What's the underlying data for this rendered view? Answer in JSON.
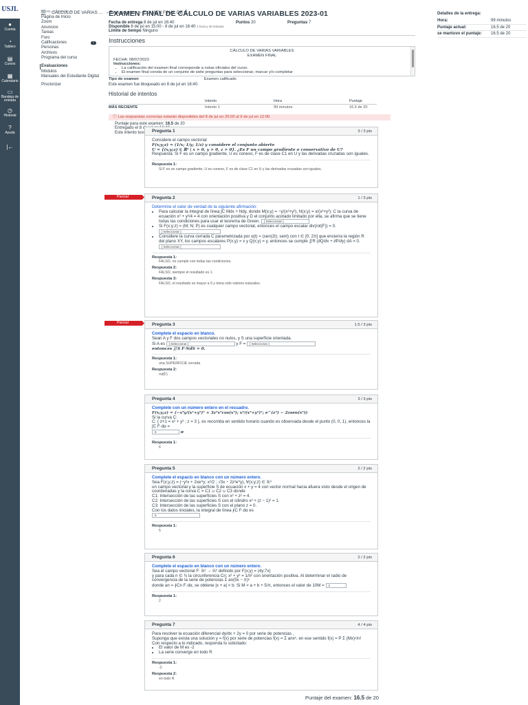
{
  "leftnav": {
    "logo": "USJL",
    "items": [
      {
        "label": "Cuenta",
        "icon": "user-icon"
      },
      {
        "label": "Tablero",
        "icon": "dashboard-icon"
      },
      {
        "label": "Cursos",
        "icon": "book-icon"
      },
      {
        "label": "Calendario",
        "icon": "calendar-icon"
      },
      {
        "label": "Bandeja de entrada",
        "icon": "inbox-icon"
      },
      {
        "label": "Historial",
        "icon": "clock-icon"
      },
      {
        "label": "Ayuda",
        "icon": "help-icon"
      }
    ],
    "collapse": "|←"
  },
  "topbar": {
    "burger": "☰",
    "crumbs": [
      "CÁLCULO DE VARIAS ...",
      "› Evaluaciones",
      "› EXAMEN FINAL DE C..."
    ]
  },
  "coursenav": {
    "term": "I - U05 - CAMBIAR UN",
    "items": [
      "Página de Inicio",
      "Zoom",
      "Anuncios",
      "Tareas",
      "Foro",
      "Calificaciones",
      "Personas",
      "Archivos",
      "Programa del curso",
      "Evaluaciones",
      "Módulos",
      "Manuales del Estudiante Digital",
      "Proctorizer"
    ],
    "badge": "1"
  },
  "exam": {
    "title": "EXAMEN FINAL DE CÁLCULO DE VARIAS VARIABLES 2023-01",
    "due_label": "Fecha de entrega",
    "due_value": "8 de jul en 16:40",
    "points_label": "Puntos",
    "points_value": "20",
    "questions_label": "Preguntas",
    "questions_value": "7",
    "available_label": "Disponible",
    "available_value": "8 de jul en 15:00 - 8 de jul en 16:40",
    "available_extra": "1 hora y 40 minutos",
    "timelimit_label": "Límite de tiempo",
    "timelimit_value": "Ninguno",
    "instructions_heading": "Instrucciones",
    "inst_course": "CÁLCULO DE VARIAS VARIABLES",
    "inst_exam": "EXAMEN FINAL",
    "inst_date": "FECHA: 08/07/2023",
    "inst_title": "Instrucciones:",
    "inst_items": [
      "La calificación del examen final corresponde a notas oficiales del curso.",
      "El examen final consta de un conjunto de siete preguntas para seleccionar, marcar y/o completar"
    ],
    "inst_type_label": "Tipo de examen",
    "inst_type_value": "Examen calificado",
    "locked": "Este examen fue bloqueado en 8 de jul en 16:40.",
    "history_heading": "Historial de intentos",
    "history_cols": [
      "Intento",
      "Hora",
      "Puntaje"
    ],
    "history_rows": [
      [
        "MÁS RECIENTE",
        "Intento 1",
        "99 minutos",
        "16.5 de 20"
      ]
    ],
    "warning": "ⓘ Las respuestas correctas estarán disponibles del 8 de jul en 20:00 al 9 de jul en 12:00.",
    "score_line_pre": "Puntaje para este examen:",
    "score_line_value": "16.5",
    "score_line_post": "de 20",
    "submitted": "Entregado el 8 de jul en 16:40",
    "duration": "Este intento tuvo una duración de 99 minutos."
  },
  "side": {
    "title": "Detalles de la entrega:",
    "rows": [
      [
        "Hora:",
        "99 minutos"
      ],
      [
        "Puntaje actual:",
        "16.5 de 20"
      ],
      [
        "se mantuvo el puntaje:",
        "16.5 de 20"
      ]
    ]
  },
  "partial_label": "Parcial",
  "questions": [
    {
      "title": "Pregunta 1",
      "pts": "3 / 3 pts",
      "lines": [
        "Considere el campo vectorial",
        "F(x;y;z) = (1/x; 1/y; 1/z)   y considere el conjunto abierto",
        "U = {(x;y;z) ∈ ℝ³ | x > 0, y > 0, z > 0}. ¿Es F un campo gradiente o conservativo de U?",
        "Respuesta: Si F es un campo gradiente, U es conexo, F es de clase C1 en U y las derivadas cruzadas son iguales."
      ],
      "answers": [
        {
          "label": "Respuesta 1:",
          "text": "Si F es un campo gradiente, U es conexo, F es de clase C1 en U y las derivadas cruzadas son iguales."
        }
      ]
    },
    {
      "title": "Pregunta 2",
      "pts": "1 / 3 pts",
      "heading": "Determine el valor de verdad de la siguiente afirmación:",
      "bullets": [
        "Para calcular la integral de línea ∫C Mdx + Ndy, donde M(x;y) = −y/(x²+y²), N(x;y) = x/(x²+y²); C la curva de ecuación x² + y²/4 = 4 con orientación positiva y D el conjunto acotado limitado por ella, se afirma que se tiene todas las condiciones para usar el teorema de Green.",
        "Si F(x;y;z) = (M; N; P) es cualquier campo vectorial, entonces el campo escalar div(rot(F)) = 0.",
        "Considere la curva cerrada C parametrizada por α(t) = (sen(2t); sent) con t ∈ [0; 2π] que encierra la región R del plano XY, los campos escalares P(x;y) = x y Q(x;y) = y, entonces se cumple ∬R (∂Q/∂x + ∂P/∂y) dA = 0."
      ],
      "select": "[ Seleccionar ]",
      "answers": [
        {
          "label": "Respuesta 1:",
          "text": "FALSO, no cumple con todas las condiciones."
        },
        {
          "label": "Respuesta 2:",
          "text": "FALSO, siempre el resultado es 1."
        },
        {
          "label": "Respuesta 3:",
          "text": "FALSO, el resultado es mayor a 0 y toma sólo valores naturales."
        }
      ]
    },
    {
      "title": "Pregunta 3",
      "pts": "1.5 / 3 pts",
      "heading": "Complete el espacio en blanco.",
      "lines": [
        "Sean A y F dos campos vectoriales no nulos, y S una superficie orientada.",
        "Si A es",
        "y F =",
        "entonces ∬S F·NdS = 0."
      ],
      "select": "[ Seleccionar ]",
      "answers": [
        {
          "label": "Respuesta 1:",
          "text": "una SUPERFICIE cerrada"
        },
        {
          "label": "Respuesta 2:",
          "text": "rot(F)"
        }
      ]
    },
    {
      "title": "Pregunta 4",
      "pts": "3 / 3 pts",
      "heading": "Complete con un número entero en el recuadro.",
      "lines": [
        "F(x;y;z) = (−x⁴y/(x²+y²)² + 3z²x²cos(x³); x⁴/(x²+y²)²; e^(z³) − 2zsen(x³))",
        "Si la curva C:",
        "C: { z+1 = x² + y² ; z = 3 }, es recorrida en sentido horario cuando es observada desde el punto (0, 0, 1), entonces la ∫C F·dα =",
        "π"
      ],
      "input": "6",
      "answers": [
        {
          "label": "Respuesta 1:",
          "text": "6"
        }
      ]
    },
    {
      "title": "Pregunta 5",
      "pts": "2 / 2 pts",
      "heading": "Complete el espacio en blanco con un número entero.",
      "lines": [
        "Sea F(x;y;z) = (−y²x + 2xe^y; x²/2 ; √3x − 2z²e^y), ∀(x;y;z) ∈ ℝ³",
        "un campo vectorial y la superficie S de ecuación x + y = 4 con vector normal hacia afuera visto desde el origen de coordenadas y la curva C = C1 ∪ C2 ∪ C3 donde",
        "C1: Intersección de las superficies S con x² + z² = 4.",
        "C2: Intersección de las superficies S con el cilindro x² + (z − 1)² = 1.",
        "C3: Intersección de las superficies S con el plano z = 0.",
        "Con los datos iniciales, la integral de línea ∮C F·dα es"
      ],
      "input": "5",
      "answers": [
        {
          "label": "Respuesta 1:",
          "text": "5"
        }
      ]
    },
    {
      "title": "Pregunta 6",
      "pts": "2 / 2 pts",
      "heading": "Complete el espacio en blanco con un número entero.",
      "lines": [
        "Sea el campo vectorial F: ℝ² → ℝ² definido por F(x;y) = (4y;7x)",
        "y para cada n ∈ ℕ la circunferencia Cn: x² + y² = 1/n² con orientación positiva. Al determinar el radio de convergencia de la serie de potencias Σ an(5x − π)ⁿ",
        "donde an = ∮Cn F·dα, se obtiene |x + a| < b. Si M = a + b + 5/π, entonces el valor de 10M ="
      ],
      "input": "2",
      "answers": [
        {
          "label": "Respuesta 1:",
          "text": "2"
        }
      ]
    },
    {
      "title": "Pregunta 7",
      "pts": "4 / 4 pts",
      "lines": [
        "Para resolver la ecuación diferencial dy/dx + 2y = 0 por serie de potencias ,",
        "Suponga que exista una solución y = f(x) por serie de potencias f(x) = Σ anxⁿ, en ese sentido f(x) = P Σ (Mx)ⁿ/n!",
        "Con respecto a lo indicado, responda lo solicitado:"
      ],
      "bullets": [
        "El valor de M es -2",
        "La serie converge en todo R"
      ],
      "answers": [
        {
          "label": "Respuesta 1:",
          "text": "-2"
        },
        {
          "label": "Respuesta 2:",
          "text": "en todo R"
        }
      ]
    }
  ],
  "footer": {
    "label": "Puntaje del examen:",
    "value": "16.5",
    "post": "de 20"
  }
}
